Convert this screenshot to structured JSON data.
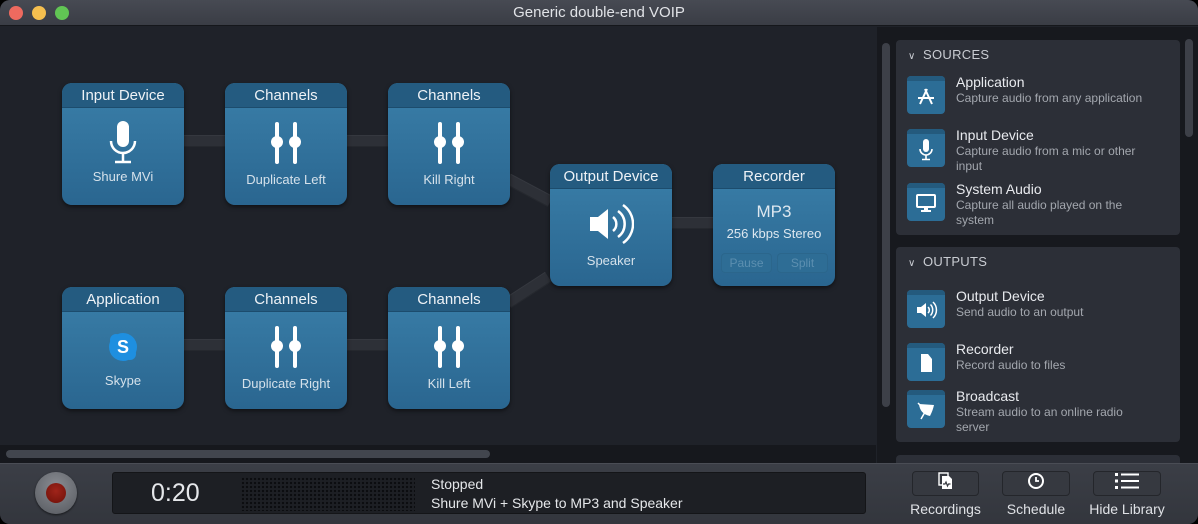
{
  "window": {
    "title": "Generic double-end VOIP",
    "traffic_lights": {
      "close": "#ee6a5f",
      "minimize": "#f5bf4f",
      "maximize": "#61c554"
    }
  },
  "canvas": {
    "nodes": {
      "input_device": {
        "header": "Input Device",
        "label": "Shure MVi",
        "icon": "microphone-icon"
      },
      "channels_1": {
        "header": "Channels",
        "label": "Duplicate Left",
        "icon": "sliders-icon"
      },
      "channels_2": {
        "header": "Channels",
        "label": "Kill Right",
        "icon": "sliders-icon"
      },
      "application": {
        "header": "Application",
        "label": "Skype",
        "icon": "skype-icon"
      },
      "channels_3": {
        "header": "Channels",
        "label": "Duplicate Right",
        "icon": "sliders-icon"
      },
      "channels_4": {
        "header": "Channels",
        "label": "Kill Left",
        "icon": "sliders-icon"
      },
      "output_device": {
        "header": "Output Device",
        "label": "Speaker",
        "icon": "speaker-icon"
      },
      "recorder": {
        "header": "Recorder",
        "format": "MP3",
        "quality": "256 kbps Stereo",
        "pause_label": "Pause",
        "split_label": "Split"
      }
    }
  },
  "library": {
    "sources": {
      "header": "SOURCES",
      "items": [
        {
          "title": "Application",
          "desc": "Capture audio from any application",
          "icon": "app-store-icon"
        },
        {
          "title": "Input Device",
          "desc": "Capture audio from a mic or other input",
          "icon": "microphone-icon"
        },
        {
          "title": "System Audio",
          "desc": "Capture all audio played on the system",
          "icon": "monitor-icon"
        }
      ]
    },
    "outputs": {
      "header": "OUTPUTS",
      "items": [
        {
          "title": "Output Device",
          "desc": "Send audio to an output",
          "icon": "speaker-icon"
        },
        {
          "title": "Recorder",
          "desc": "Record audio to files",
          "icon": "document-icon"
        },
        {
          "title": "Broadcast",
          "desc": "Stream audio to an online radio server",
          "icon": "satellite-dish-icon"
        }
      ]
    }
  },
  "toolbar": {
    "time": "0:20",
    "status": "Stopped",
    "description": "Shure MVi + Skype to MP3 and Speaker",
    "recordings_label": "Recordings",
    "schedule_label": "Schedule",
    "hide_library_label": "Hide Library"
  },
  "colors": {
    "node_blue": "#2f6f99",
    "node_header": "#245b80",
    "record_red": "#8b1a10"
  }
}
